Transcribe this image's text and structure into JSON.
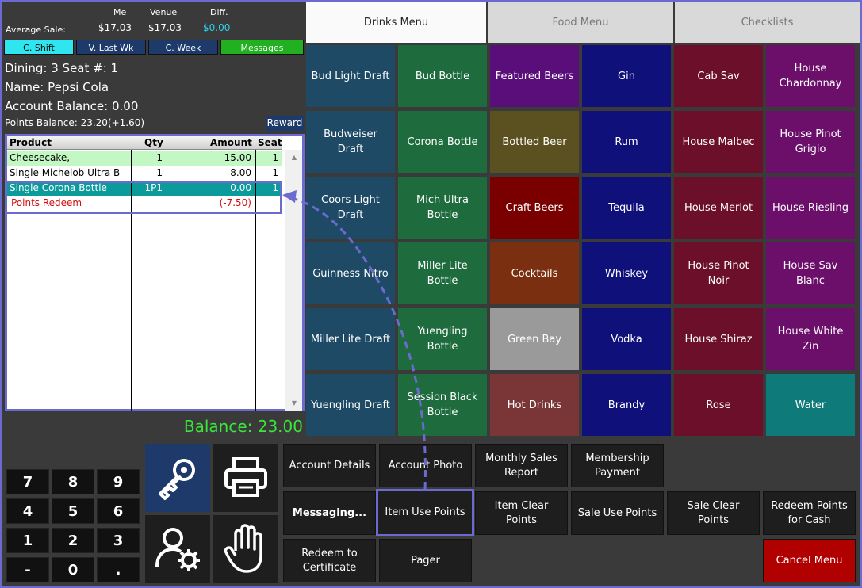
{
  "stats": {
    "avg_label": "Average Sale:",
    "col_me": "Me",
    "col_venue": "Venue",
    "col_diff": "Diff.",
    "val_me": "$17.03",
    "val_venue": "$17.03",
    "val_diff": "$0.00"
  },
  "shift_tabs": [
    "C. Shift",
    "V. Last Wk",
    "C. Week",
    "Messages"
  ],
  "customer": {
    "dining": "Dining: 3  Seat #: 1",
    "name": "Name: Pepsi  Cola",
    "account_balance": "Account Balance: 0.00",
    "points_balance": "Points Balance: 23.20(+1.60)",
    "reward_label": "Reward"
  },
  "order": {
    "headers": [
      "Product",
      "Qty",
      "Amount",
      "Seat"
    ],
    "rows": [
      {
        "product": "Cheesecake,",
        "qty": "1",
        "amount": "15.00",
        "seat": "1"
      },
      {
        "product": "Single Michelob Ultra B",
        "qty": "1",
        "amount": "8.00",
        "seat": "1"
      },
      {
        "product": "Single Corona Bottle",
        "qty": "1P1",
        "amount": "0.00",
        "seat": "1"
      },
      {
        "product": "Points Redeem",
        "qty": "",
        "amount": "(-7.50)",
        "seat": ""
      }
    ]
  },
  "balance": "Balance: 23.00",
  "menu_tabs": [
    "Drinks Menu",
    "Food Menu",
    "Checklists"
  ],
  "drinks": [
    [
      "Bud Light Draft",
      "Bud Bottle",
      "Featured Beers",
      "Gin",
      "Cab Sav",
      "House Chardonnay"
    ],
    [
      "Budweiser Draft",
      "Corona Bottle",
      "Bottled Beer",
      "Rum",
      "House Malbec",
      "House Pinot Grigio"
    ],
    [
      "Coors Light Draft",
      "Mich Ultra Bottle",
      "Craft Beers",
      "Tequila",
      "House Merlot",
      "House Riesling"
    ],
    [
      "Guinness Nitro",
      "Miller Lite Bottle",
      "Cocktails",
      "Whiskey",
      "House Pinot Noir",
      "House Sav Blanc"
    ],
    [
      "Miller Lite Draft",
      "Yuengling Bottle",
      "Green Bay",
      "Vodka",
      "House Shiraz",
      "House White Zin"
    ],
    [
      "Yuengling Draft",
      "Session Black Bottle",
      "Hot Drinks",
      "Brandy",
      "Rose",
      "Water"
    ]
  ],
  "colors": {
    "draft": "#1e4a66",
    "bottle": "#1e6b3e",
    "featured": "#5a0e7a",
    "spirit": "#10107a",
    "red_wine": "#6b0f2a",
    "white_wine": "#6b0f6b",
    "bottled": "#5a5020",
    "craft": "#7a0000",
    "cocktails": "#7a3010",
    "greenbay": "#9a9a9a",
    "hotdrinks": "#7a3636",
    "water": "#0e7a7a",
    "accent": "#6b6bcf",
    "balance": "#39e639"
  },
  "numpad": [
    "7",
    "8",
    "9",
    "4",
    "5",
    "6",
    "1",
    "2",
    "3",
    "-",
    "0",
    "."
  ],
  "icons": [
    "key-icon",
    "printer-icon",
    "user-settings-icon",
    "hand-icon"
  ],
  "functions": {
    "account_details": "Account Details",
    "account_photo": "Account Photo",
    "monthly_sales": "Monthly Sales Report",
    "membership_payment": "Membership Payment",
    "messaging": "Messaging...",
    "item_use_points": "Item Use Points",
    "item_clear_points": "Item Clear Points",
    "sale_use_points": "Sale Use Points",
    "sale_clear_points": "Sale Clear Points",
    "redeem_cash": "Redeem Points for Cash",
    "redeem_certificate": "Redeem to Certificate",
    "pager": "Pager",
    "cancel_menu": "Cancel Menu"
  }
}
